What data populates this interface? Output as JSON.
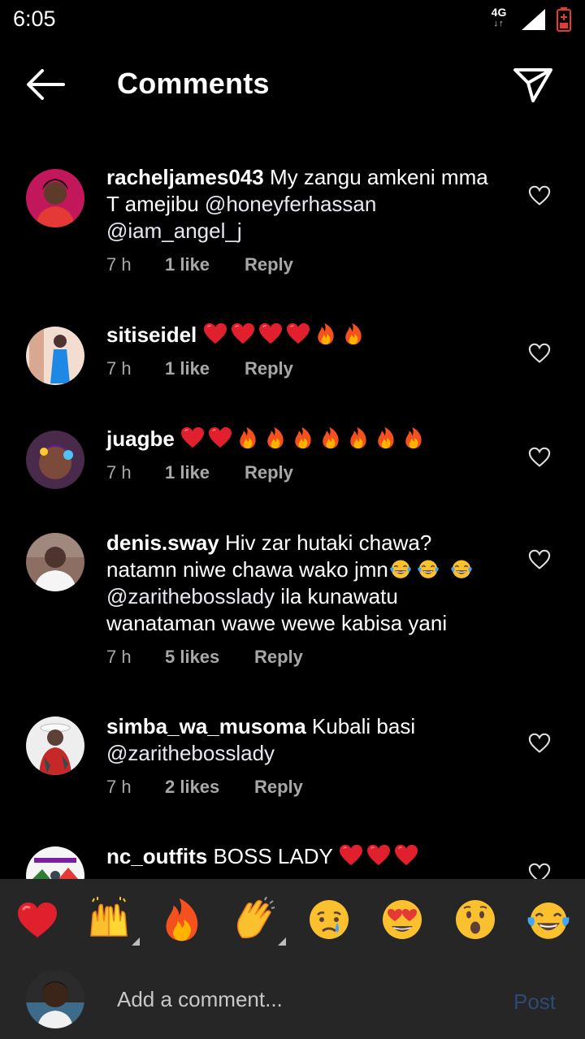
{
  "status_bar": {
    "time": "6:05",
    "network": "4G"
  },
  "header": {
    "title": "Comments"
  },
  "comments": [
    {
      "username": "racheljames043",
      "text": " My zangu amkeni mma T amejibu ",
      "mention1": "@honeyferhassan",
      "mention2": "@iam_angel_j",
      "time": "7 h",
      "likes": "1 like",
      "reply": "Reply"
    },
    {
      "username": "sitiseidel",
      "emojis": [
        "red-heart",
        "red-heart",
        "red-heart",
        "red-heart",
        "fire",
        "fire"
      ],
      "time": "7 h",
      "likes": "1 like",
      "reply": "Reply"
    },
    {
      "username": "juagbe",
      "emojis": [
        "red-heart",
        "red-heart",
        "fire",
        "fire",
        "fire",
        "fire",
        "fire",
        "fire",
        "fire"
      ],
      "time": "7 h",
      "likes": "1 like",
      "reply": "Reply"
    },
    {
      "username": "denis.sway",
      "text1": " Hiv zar hutaki chawa? natamn niwe chawa wako jmn",
      "mention": "@zarithebosslady",
      "text2": " ila kunawatu wanataman wawe wewe kabisa yani",
      "time": "7 h",
      "likes": "5 likes",
      "reply": "Reply"
    },
    {
      "username": "simba_wa_musoma",
      "text": " Kubali basi ",
      "mention": "@zarithebosslady",
      "time": "7 h",
      "likes": "2 likes",
      "reply": "Reply"
    },
    {
      "username": "nc_outfits",
      "text": " BOSS LADY "
    }
  ],
  "reactions": [
    "red-heart",
    "raising-hands",
    "fire",
    "clapping-hands",
    "crying-face",
    "heart-eyes-face",
    "surprised-face",
    "tears-of-joy-face"
  ],
  "composer": {
    "placeholder": "Add a comment...",
    "post_label": "Post"
  },
  "colors": {
    "background": "#000000",
    "bottom_bar": "#262626",
    "post_disabled": "#2c4a73",
    "meta_text": "#a8a8a8"
  }
}
